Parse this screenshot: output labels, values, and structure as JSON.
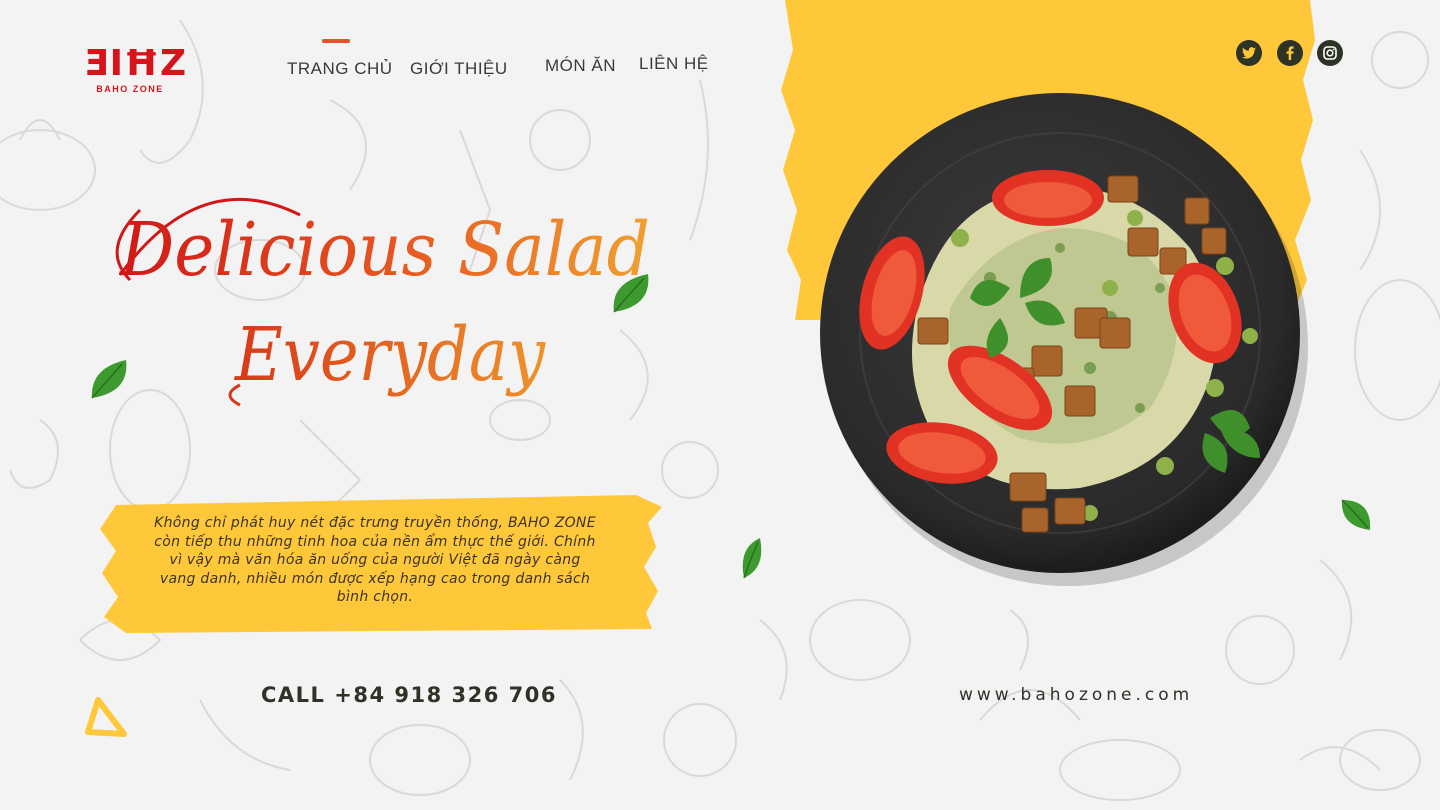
{
  "brand": {
    "logo_mark": "ƎIĦZ",
    "logo_subtitle": "BAHO ZONE",
    "color": "#d6141c"
  },
  "nav": {
    "items": [
      {
        "label": "TRANG CHỦ"
      },
      {
        "label": "GIỚI THIỆU"
      },
      {
        "label": "MÓN ĂN"
      },
      {
        "label": "LIÊN HỆ"
      }
    ]
  },
  "social": {
    "icons": [
      "twitter-icon",
      "facebook-icon",
      "instagram-icon"
    ]
  },
  "hero": {
    "headline_line1": "Delicious Salad",
    "headline_line2": "Everyday",
    "blurb": "Không chỉ phát huy nét đặc trưng truyền thống, BAHO ZONE còn tiếp thu những tinh hoa của nền ẩm thực thế giới. Chính vì vậy mà văn hóa ăn uống của người Việt đã ngày càng vang danh, nhiều món được xếp hạng cao trong danh sách bình chọn."
  },
  "footer": {
    "call": "CALL +84 918 326 706",
    "website": "www.bahozone.com"
  },
  "colors": {
    "accent_yellow": "#ffc83a",
    "headline_red": "#d01818",
    "headline_orange": "#f0922a",
    "dark_text": "#2d3326",
    "leaf_green": "#3c9a2e"
  }
}
